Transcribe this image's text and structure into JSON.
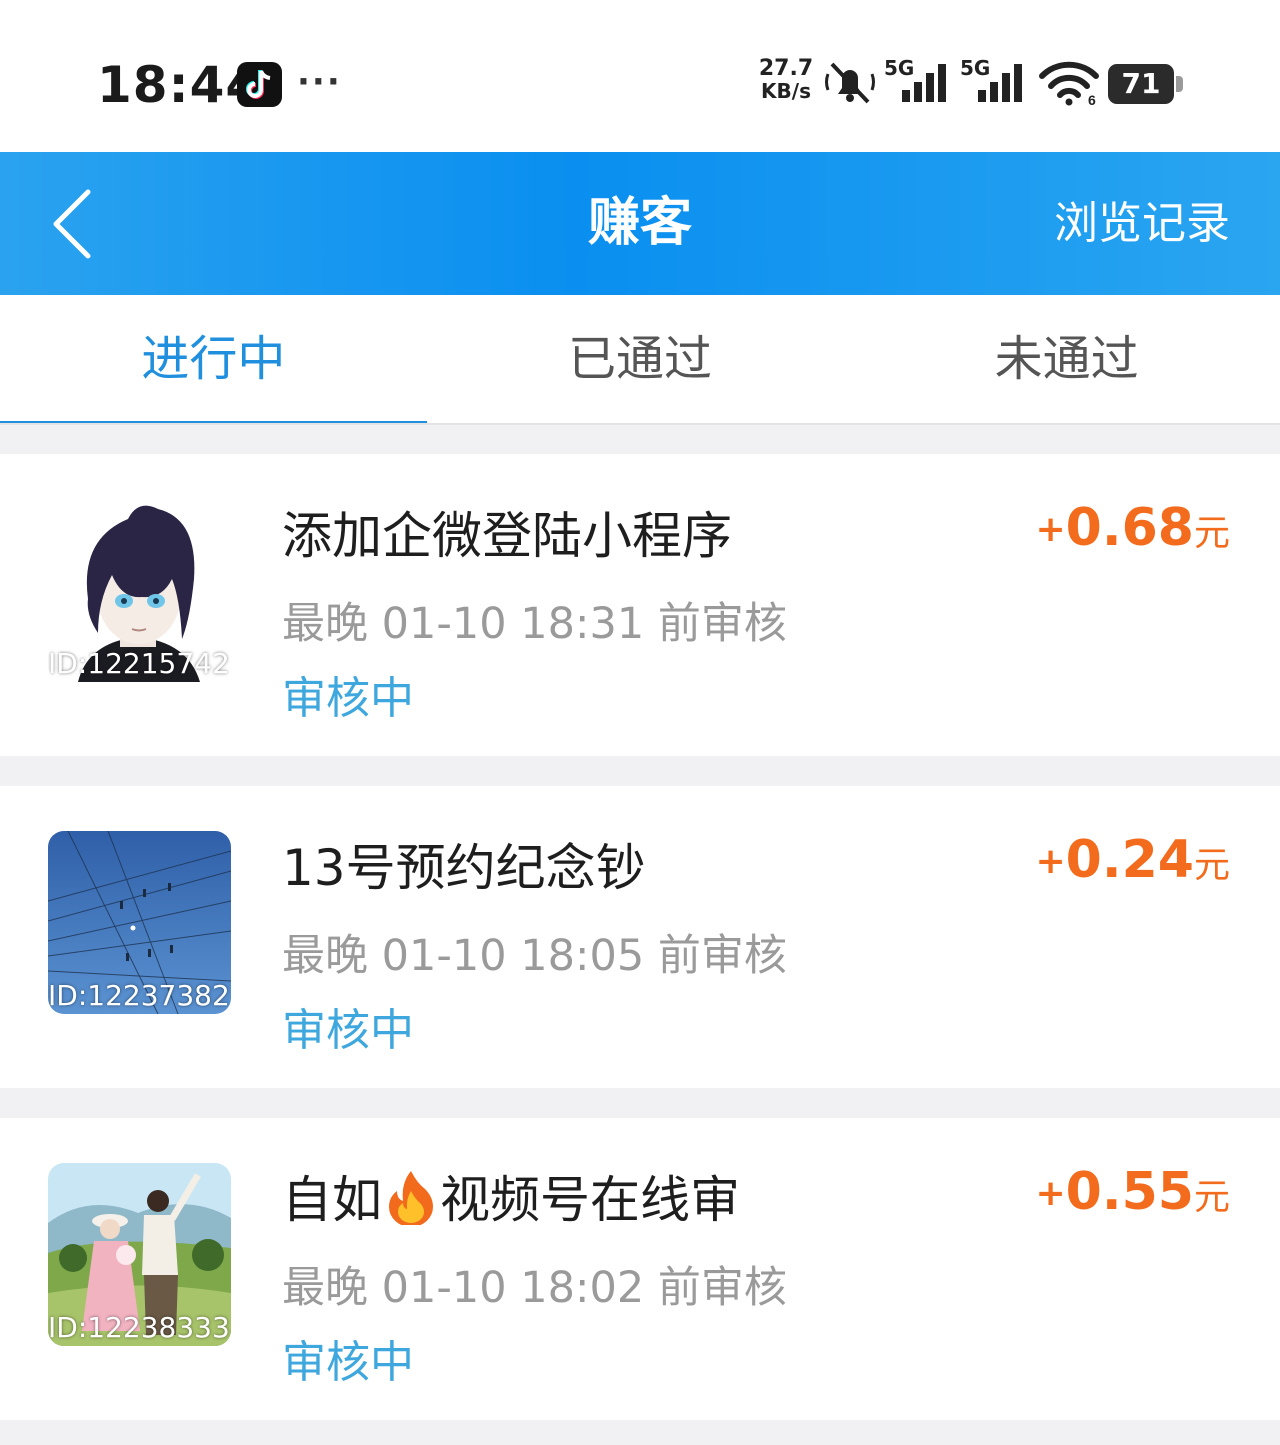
{
  "status_bar": {
    "time": "18:44",
    "more": "···",
    "net_speed_value": "27.7",
    "net_speed_unit": "KB/s",
    "signal1_label": "5G",
    "signal2_label": "5G",
    "battery": "71",
    "icons": [
      "tiktok-icon",
      "mute-icon",
      "signal-5g-icon",
      "signal-5g-icon",
      "wifi-icon",
      "battery-icon"
    ]
  },
  "header": {
    "title": "赚客",
    "right_action": "浏览记录"
  },
  "tabs": [
    {
      "label": "进行中",
      "active": true
    },
    {
      "label": "已通过",
      "active": false
    },
    {
      "label": "未通过",
      "active": false
    }
  ],
  "tasks": [
    {
      "thumb_id": "ID:12215742",
      "title": "添加企微登陆小程序",
      "deadline": "最晚 01-10 18:31 前审核",
      "status": "审核中",
      "reward_plus": "+",
      "reward_value": "0.68",
      "reward_unit": "元"
    },
    {
      "thumb_id": "ID:12237382",
      "title": "13号预约纪念钞",
      "deadline": "最晚 01-10 18:05 前审核",
      "status": "审核中",
      "reward_plus": "+",
      "reward_value": "0.24",
      "reward_unit": "元"
    },
    {
      "thumb_id": "ID:12238333",
      "title_before": "自如",
      "title_after": "视频号在线审",
      "deadline": "最晚 01-10 18:02 前审核",
      "status": "审核中",
      "reward_plus": "+",
      "reward_value": "0.55",
      "reward_unit": "元"
    }
  ],
  "colors": {
    "header_blue": "#1a96ef",
    "active_tab": "#1f8fde",
    "status_blue": "#3ea7dd",
    "reward_orange": "#f36b1c"
  }
}
